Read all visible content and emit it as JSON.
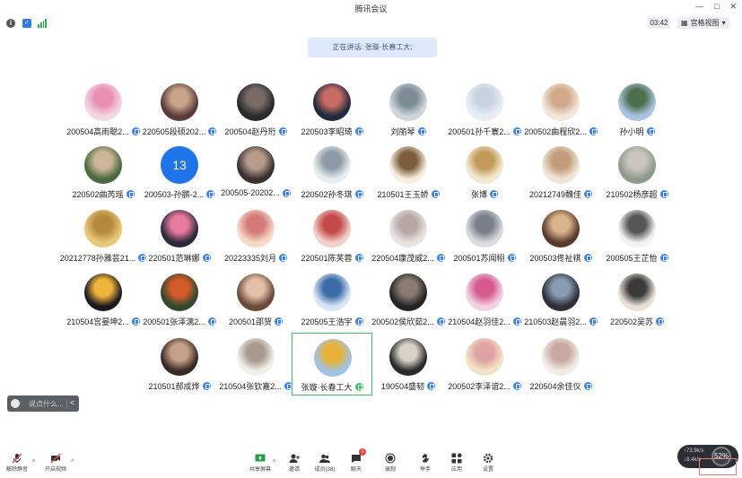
{
  "window": {
    "title": "腾讯会议"
  },
  "window_controls": {
    "minimize": "—",
    "maximize": "□",
    "close": "✕"
  },
  "status": {
    "timer": "03:42",
    "view_label": "宫格视图"
  },
  "speaker_banner": "正在讲话: 张璇·长春工大;",
  "participants": [
    "200504高雨聪2...",
    "220505段硕202...",
    "200504赵丹珩",
    "220503李昭琦",
    "刘丽琴",
    "200501孙千寰2...",
    "200502曲程欣2...",
    "孙小明",
    "220502曲芮瑶",
    "200503-孙鹏-2...",
    "200505-20202...",
    "220502孙冬琪",
    "210501王玉娇",
    "张博",
    "20212749魏佳",
    "210502杨彦超",
    "20212778孙雅芸21...",
    "220501范琳娜",
    "20223335刘月",
    "220501陈芙蓉",
    "220504康茂威2...",
    "200501苏闻栩",
    "200503佟祉祺",
    "200505王芷怡",
    "210504宫晏坤2...",
    "200501张泽漓2...",
    "200501邵贺",
    "220505王浩宇",
    "200502侯欣茹2...",
    "210504赵羽佳2...",
    "210503赵晨羽2...",
    "220502吴苏",
    "210501郝成烨",
    "210504张钦嘉2...",
    "张璇·长春工大",
    "190504盛韧",
    "200502李泽谊2...",
    "220504余佳仪"
  ],
  "numbered_avatar": "13",
  "chat": {
    "placeholder": "说点什么...",
    "expand": "<"
  },
  "toolbar": {
    "mute": "解除静音",
    "video": "开启视频",
    "share": "共享屏幕",
    "invite": "邀请",
    "members": "成员(38)",
    "chat": "聊天",
    "record": "录制",
    "hand": "举手",
    "apps": "应用",
    "settings": "设置",
    "chat_badge": "1"
  },
  "network": {
    "up": "↑73.9k/s",
    "down": "↓8.4k/s",
    "percent": "52%"
  },
  "colors": {
    "accent": "#3b82f6",
    "active_border": "#3dbf63",
    "banner_bg": "#dfe9fb"
  }
}
